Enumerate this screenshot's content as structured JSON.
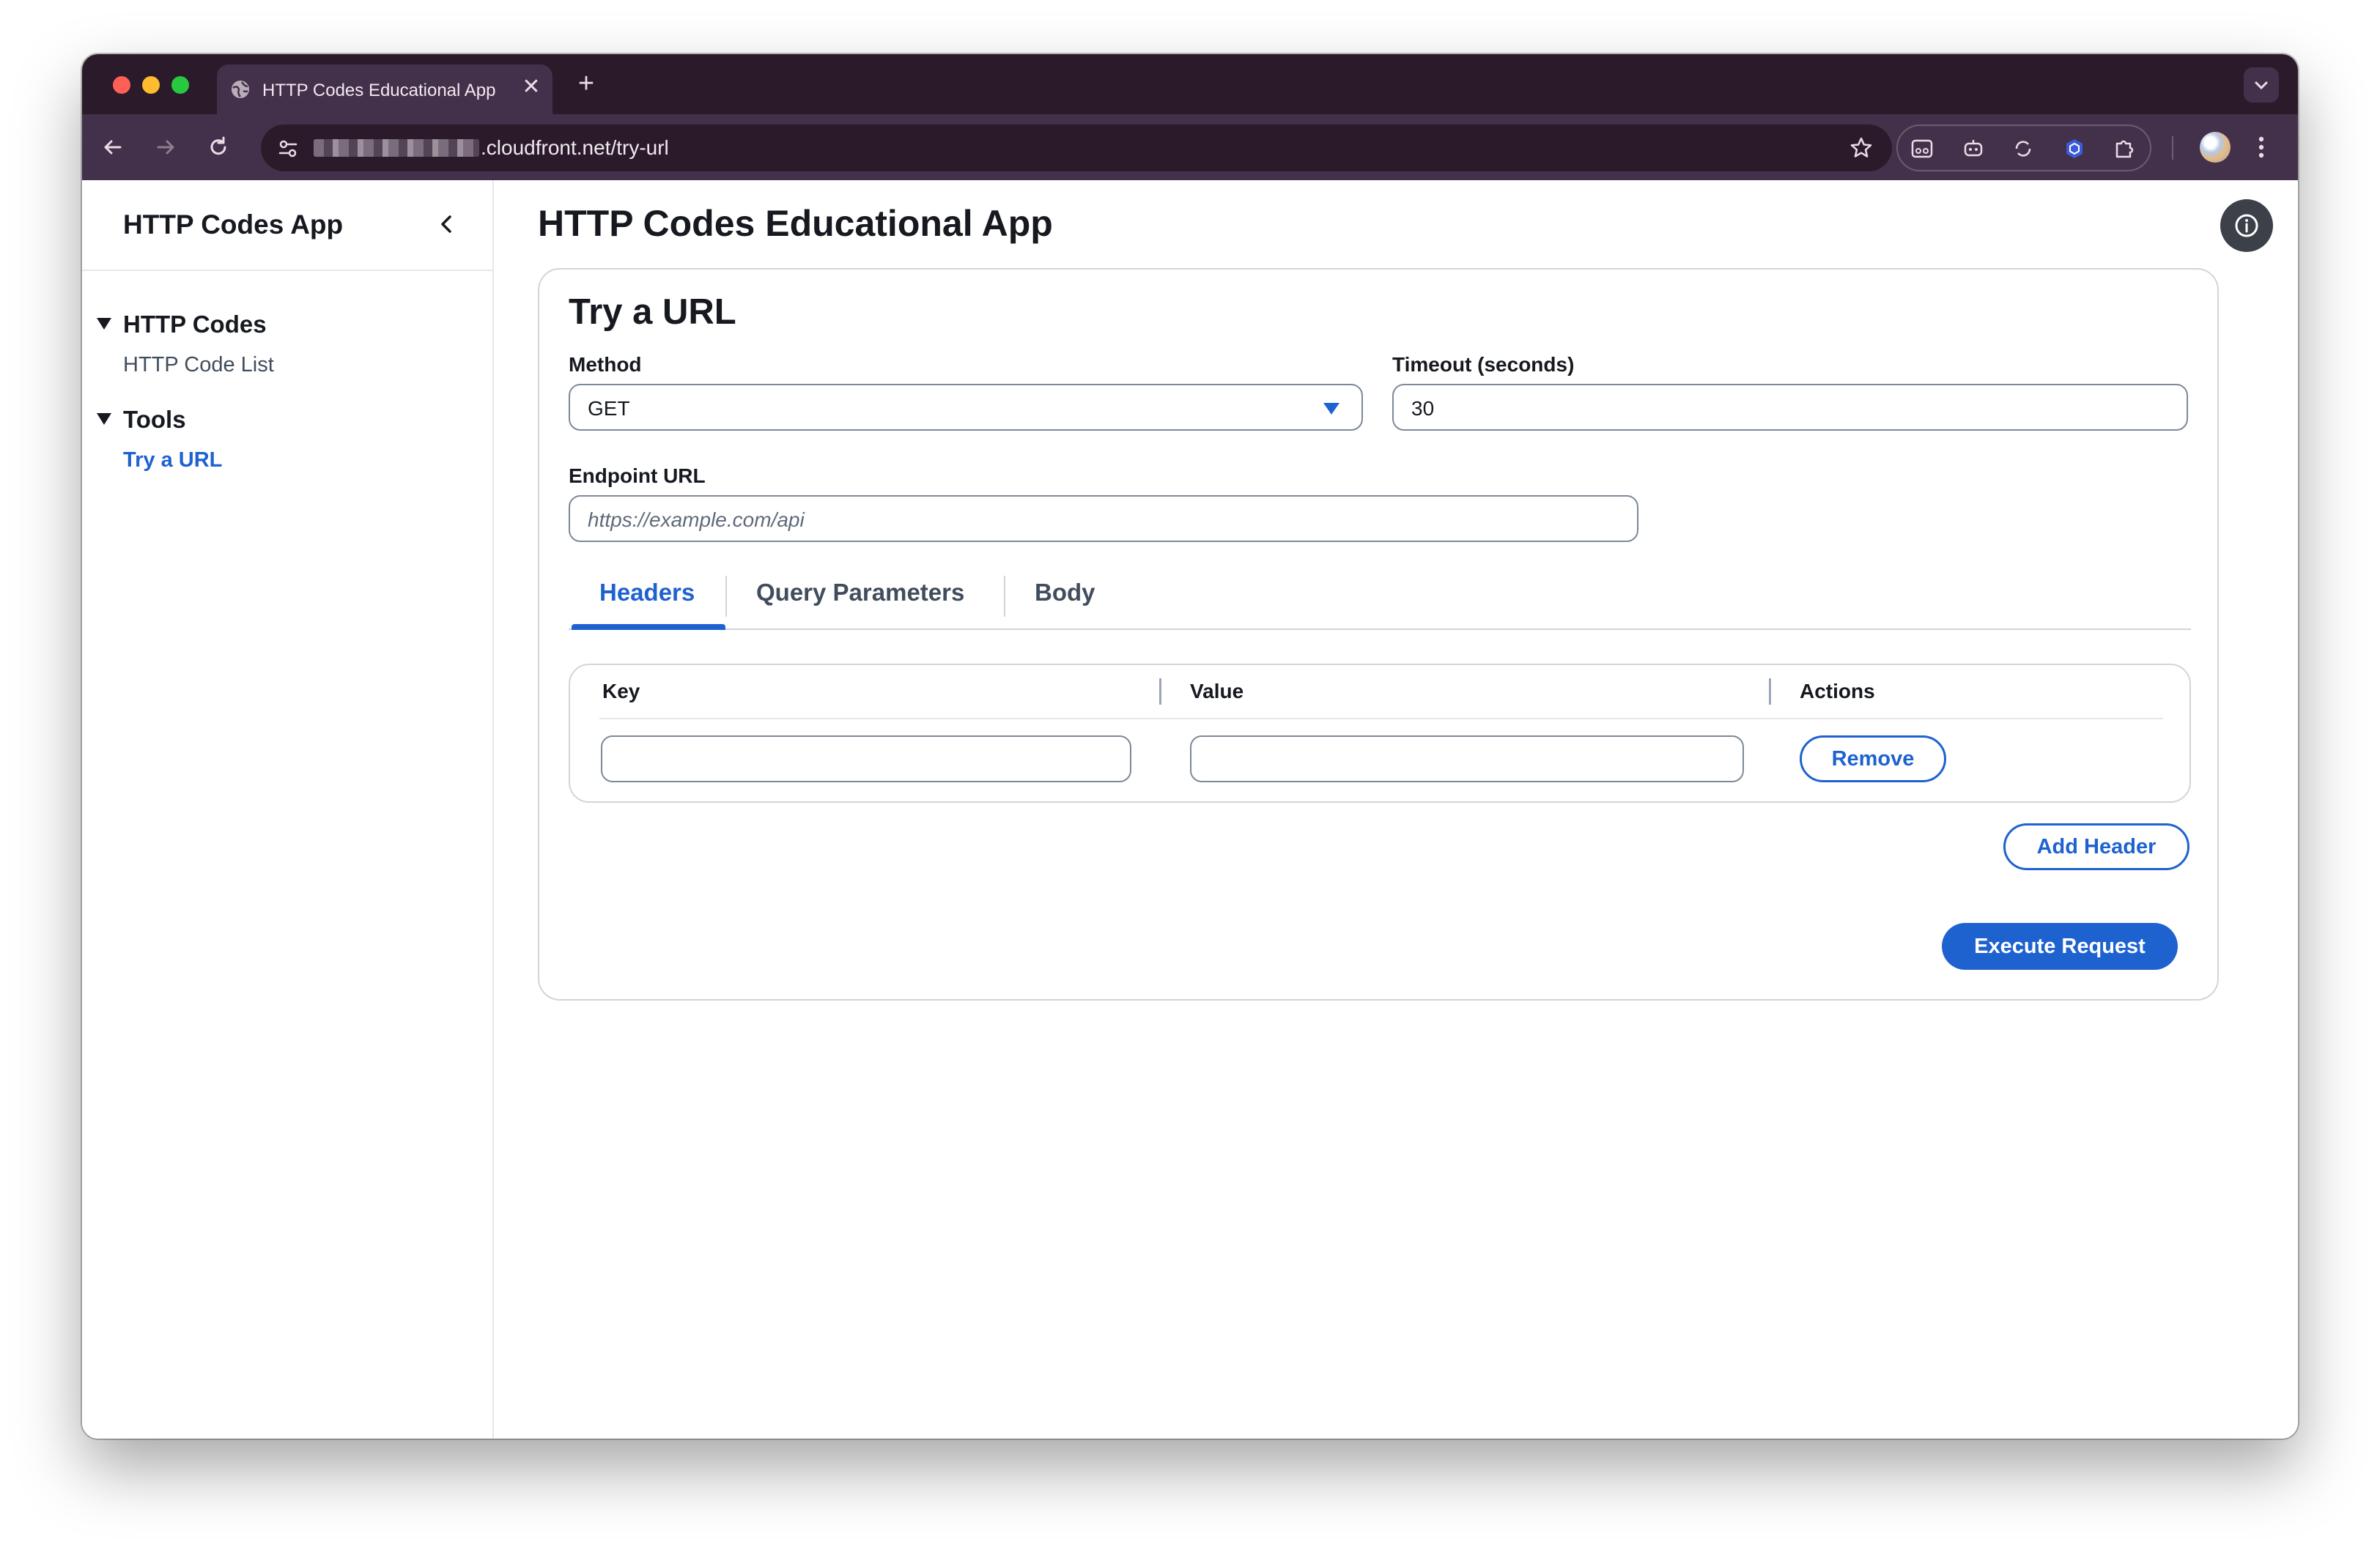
{
  "browser": {
    "tab_title": "HTTP Codes Educational App",
    "tab_close_glyph": "✕",
    "new_tab_glyph": "+",
    "url": ".cloudfront.net/try-url",
    "icons": [
      "globe-icon",
      "back-icon",
      "forward-icon",
      "reload-icon",
      "site-settings-icon",
      "bookmark-star-icon",
      "extension-icon",
      "puzzle-icon",
      "profile-avatar",
      "menu-kebab-icon"
    ]
  },
  "sidebar": {
    "title": "HTTP Codes App",
    "sections": [
      {
        "title": "HTTP Codes",
        "links": [
          {
            "label": "HTTP Code List",
            "active": false
          }
        ]
      },
      {
        "title": "Tools",
        "links": [
          {
            "label": "Try a URL",
            "active": true
          }
        ]
      }
    ]
  },
  "main": {
    "page_title": "HTTP Codes Educational App",
    "card_title": "Try a URL",
    "method": {
      "label": "Method",
      "value": "GET"
    },
    "timeout": {
      "label": "Timeout (seconds)",
      "value": "30"
    },
    "endpoint": {
      "label": "Endpoint URL",
      "placeholder": "https://example.com/api",
      "value": ""
    },
    "tabs": [
      {
        "label": "Headers",
        "active": true
      },
      {
        "label": "Query Parameters",
        "active": false
      },
      {
        "label": "Body",
        "active": false
      }
    ],
    "headers_table": {
      "columns": [
        "Key",
        "Value",
        "Actions"
      ],
      "rows": [
        {
          "key": "",
          "value": "",
          "action": "Remove"
        }
      ]
    },
    "add_header_label": "Add Header",
    "execute_label": "Execute Request"
  },
  "colors": {
    "accent": "#1e62d0",
    "browser_frame": "#2b1b2a",
    "browser_toolbar": "#43304a",
    "text": "#16191f"
  }
}
